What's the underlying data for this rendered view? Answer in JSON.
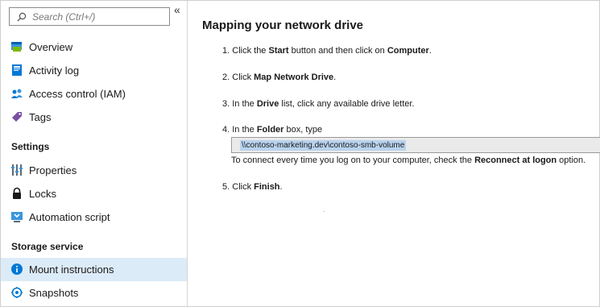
{
  "search": {
    "placeholder": "Search (Ctrl+/)"
  },
  "collapse_glyph": "«",
  "sidebar": {
    "top_items": [
      {
        "label": "Overview",
        "icon": "overview-icon"
      },
      {
        "label": "Activity log",
        "icon": "activity-log-icon"
      },
      {
        "label": "Access control (IAM)",
        "icon": "iam-users-icon"
      },
      {
        "label": "Tags",
        "icon": "tag-icon"
      }
    ],
    "settings_heading": "Settings",
    "settings_items": [
      {
        "label": "Properties",
        "icon": "properties-sliders-icon"
      },
      {
        "label": "Locks",
        "icon": "lock-icon"
      },
      {
        "label": "Automation script",
        "icon": "automation-script-icon"
      }
    ],
    "storage_heading": "Storage service",
    "storage_items": [
      {
        "label": "Mount instructions",
        "icon": "info-icon",
        "active": true
      },
      {
        "label": "Snapshots",
        "icon": "snapshot-icon"
      }
    ]
  },
  "main": {
    "heading": "Mapping your network drive",
    "steps": {
      "s1": {
        "num": "1.",
        "pre": " Click the ",
        "b1": "Start",
        "mid": " button and then click on ",
        "b2": "Computer",
        "post": "."
      },
      "s2": {
        "num": "2.",
        "pre": " Click ",
        "b1": "Map Network Drive",
        "post": "."
      },
      "s3": {
        "num": "3.",
        "pre": " In the ",
        "b1": "Drive",
        "post": " list, click any available drive letter."
      },
      "s4": {
        "num": "4.",
        "pre": " In the ",
        "b1": "Folder",
        "post": " box, type"
      },
      "path": "\\\\contoso-marketing.dev\\contoso-smb-volume",
      "reconnect": {
        "pre": "To connect every time you log on to your computer, check the ",
        "b1": "Reconnect at logon",
        "post": " option."
      },
      "s5": {
        "num": "5.",
        "pre": " Click ",
        "b1": "Finish",
        "post": "."
      }
    }
  },
  "colors": {
    "active_bg": "#dcebf8",
    "selection_bg": "#b9d3ee",
    "azure_blue": "#0078d4"
  }
}
